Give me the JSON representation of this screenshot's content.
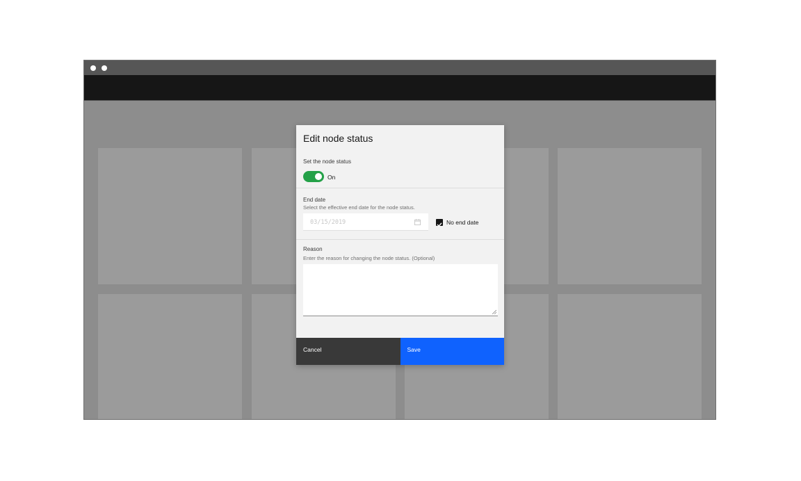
{
  "modal": {
    "title": "Edit node status",
    "status": {
      "label": "Set the node status",
      "toggle_text": "On",
      "toggle_on": true,
      "toggle_color": "#24a148"
    },
    "end_date": {
      "label": "End date",
      "helper": "Select the effective end date for the node status.",
      "placeholder": "03/15/2019",
      "calendar_icon": "calendar-icon",
      "no_end_date_label": "No end date",
      "no_end_date_checked": true
    },
    "reason": {
      "label": "Reason",
      "helper": "Enter the reason for changing the node status. (Optional)",
      "value": ""
    },
    "buttons": {
      "cancel": "Cancel",
      "save": "Save",
      "save_color": "#0f62fe"
    }
  }
}
